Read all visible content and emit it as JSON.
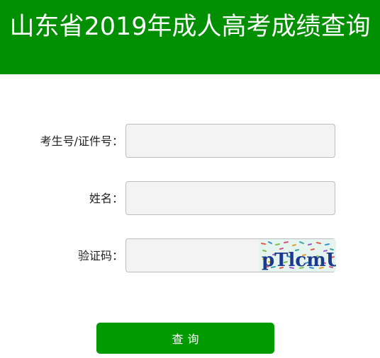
{
  "header": {
    "title": "山东省2019年成人高考成绩查询"
  },
  "form": {
    "exam_id": {
      "label": "考生号/证件号：",
      "value": ""
    },
    "name": {
      "label": "姓名：",
      "value": ""
    },
    "captcha": {
      "label": "验证码：",
      "value": "",
      "image_text": "pTlcmU"
    },
    "submit_label": "查询"
  }
}
